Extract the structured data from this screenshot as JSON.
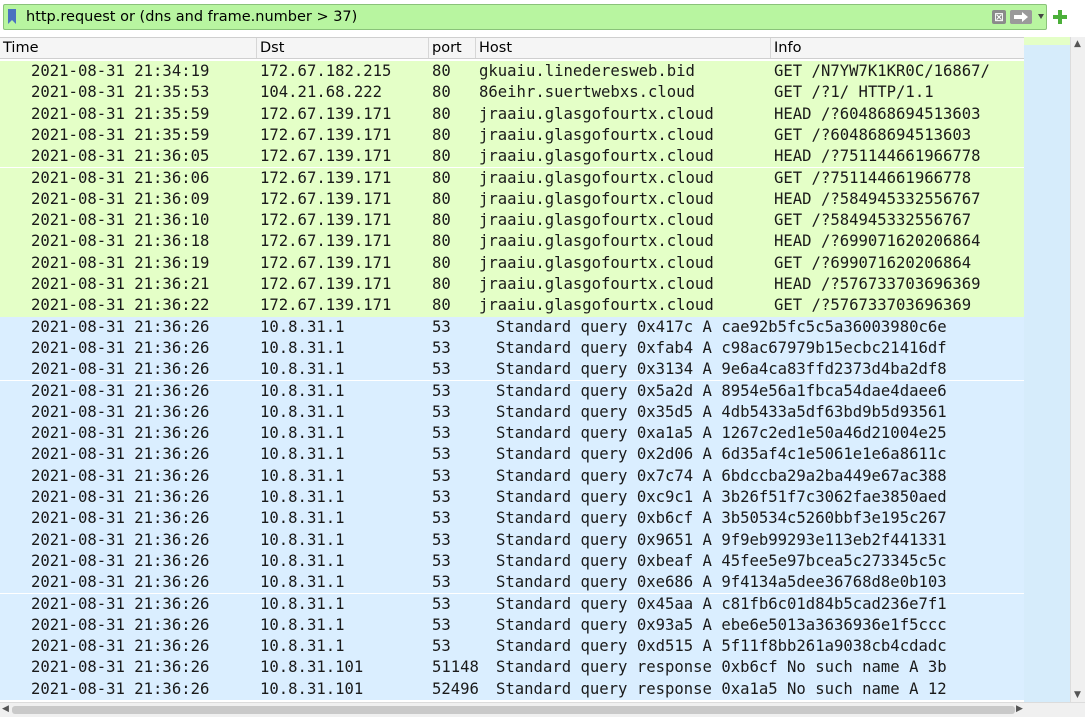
{
  "filter": {
    "value": "http.request or (dns and frame.number > 37)",
    "clear_glyph": "⊠"
  },
  "columns": [
    "Time",
    "Dst",
    "port",
    "Host",
    "Info"
  ],
  "rows": [
    {
      "kind": "http",
      "time": "2021-08-31 21:34:19",
      "dst": "172.67.182.215",
      "port": "80",
      "host": "gkuaiu.linederesweb.bid",
      "info": "GET /N7YW7K1KR0C/16867/"
    },
    {
      "kind": "http",
      "time": "2021-08-31 21:35:53",
      "dst": "104.21.68.222",
      "port": "80",
      "host": "86eihr.suertwebxs.cloud",
      "info": "GET /?1/ HTTP/1.1"
    },
    {
      "kind": "http",
      "time": "2021-08-31 21:35:59",
      "dst": "172.67.139.171",
      "port": "80",
      "host": "jraaiu.glasgofourtx.cloud",
      "info": "HEAD /?604868694513603"
    },
    {
      "kind": "http",
      "time": "2021-08-31 21:35:59",
      "dst": "172.67.139.171",
      "port": "80",
      "host": "jraaiu.glasgofourtx.cloud",
      "info": "GET /?604868694513603"
    },
    {
      "kind": "http",
      "time": "2021-08-31 21:36:05",
      "dst": "172.67.139.171",
      "port": "80",
      "host": "jraaiu.glasgofourtx.cloud",
      "info": "HEAD /?751144661966778"
    },
    {
      "kind": "http",
      "time": "2021-08-31 21:36:06",
      "dst": "172.67.139.171",
      "port": "80",
      "host": "jraaiu.glasgofourtx.cloud",
      "info": "GET /?751144661966778"
    },
    {
      "kind": "http",
      "time": "2021-08-31 21:36:09",
      "dst": "172.67.139.171",
      "port": "80",
      "host": "jraaiu.glasgofourtx.cloud",
      "info": "HEAD /?584945332556767"
    },
    {
      "kind": "http",
      "time": "2021-08-31 21:36:10",
      "dst": "172.67.139.171",
      "port": "80",
      "host": "jraaiu.glasgofourtx.cloud",
      "info": "GET /?584945332556767"
    },
    {
      "kind": "http",
      "time": "2021-08-31 21:36:18",
      "dst": "172.67.139.171",
      "port": "80",
      "host": "jraaiu.glasgofourtx.cloud",
      "info": "HEAD /?699071620206864"
    },
    {
      "kind": "http",
      "time": "2021-08-31 21:36:19",
      "dst": "172.67.139.171",
      "port": "80",
      "host": "jraaiu.glasgofourtx.cloud",
      "info": "GET /?699071620206864"
    },
    {
      "kind": "http",
      "time": "2021-08-31 21:36:21",
      "dst": "172.67.139.171",
      "port": "80",
      "host": "jraaiu.glasgofourtx.cloud",
      "info": "HEAD /?576733703696369"
    },
    {
      "kind": "http",
      "time": "2021-08-31 21:36:22",
      "dst": "172.67.139.171",
      "port": "80",
      "host": "jraaiu.glasgofourtx.cloud",
      "info": "GET /?576733703696369"
    },
    {
      "kind": "dns",
      "time": "2021-08-31 21:36:26",
      "dst": "10.8.31.1",
      "port": "53",
      "info": "Standard query 0x417c A cae92b5fc5c5a36003980c6e"
    },
    {
      "kind": "dns",
      "time": "2021-08-31 21:36:26",
      "dst": "10.8.31.1",
      "port": "53",
      "info": "Standard query 0xfab4 A c98ac67979b15ecbc21416df"
    },
    {
      "kind": "dns",
      "time": "2021-08-31 21:36:26",
      "dst": "10.8.31.1",
      "port": "53",
      "info": "Standard query 0x3134 A 9e6a4ca83ffd2373d4ba2df8"
    },
    {
      "kind": "dns",
      "time": "2021-08-31 21:36:26",
      "dst": "10.8.31.1",
      "port": "53",
      "info": "Standard query 0x5a2d A 8954e56a1fbca54dae4daee6"
    },
    {
      "kind": "dns",
      "time": "2021-08-31 21:36:26",
      "dst": "10.8.31.1",
      "port": "53",
      "info": "Standard query 0x35d5 A 4db5433a5df63bd9b5d93561"
    },
    {
      "kind": "dns",
      "time": "2021-08-31 21:36:26",
      "dst": "10.8.31.1",
      "port": "53",
      "info": "Standard query 0xa1a5 A 1267c2ed1e50a46d21004e25"
    },
    {
      "kind": "dns",
      "time": "2021-08-31 21:36:26",
      "dst": "10.8.31.1",
      "port": "53",
      "info": "Standard query 0x2d06 A 6d35af4c1e5061e1e6a8611c"
    },
    {
      "kind": "dns",
      "time": "2021-08-31 21:36:26",
      "dst": "10.8.31.1",
      "port": "53",
      "info": "Standard query 0x7c74 A 6bdccba29a2ba449e67ac388"
    },
    {
      "kind": "dns",
      "time": "2021-08-31 21:36:26",
      "dst": "10.8.31.1",
      "port": "53",
      "info": "Standard query 0xc9c1 A 3b26f51f7c3062fae3850aed"
    },
    {
      "kind": "dns",
      "time": "2021-08-31 21:36:26",
      "dst": "10.8.31.1",
      "port": "53",
      "info": "Standard query 0xb6cf A 3b50534c5260bbf3e195c267"
    },
    {
      "kind": "dns",
      "time": "2021-08-31 21:36:26",
      "dst": "10.8.31.1",
      "port": "53",
      "info": "Standard query 0x9651 A 9f9eb99293e113eb2f441331"
    },
    {
      "kind": "dns",
      "time": "2021-08-31 21:36:26",
      "dst": "10.8.31.1",
      "port": "53",
      "info": "Standard query 0xbeaf A 45fee5e97bcea5c273345c5c"
    },
    {
      "kind": "dns",
      "time": "2021-08-31 21:36:26",
      "dst": "10.8.31.1",
      "port": "53",
      "info": "Standard query 0xe686 A 9f4134a5dee36768d8e0b103"
    },
    {
      "kind": "dns",
      "time": "2021-08-31 21:36:26",
      "dst": "10.8.31.1",
      "port": "53",
      "info": "Standard query 0x45aa A c81fb6c01d84b5cad236e7f1"
    },
    {
      "kind": "dns",
      "time": "2021-08-31 21:36:26",
      "dst": "10.8.31.1",
      "port": "53",
      "info": "Standard query 0x93a5 A ebe6e5013a3636936e1f5ccc"
    },
    {
      "kind": "dns",
      "time": "2021-08-31 21:36:26",
      "dst": "10.8.31.1",
      "port": "53",
      "info": "Standard query 0xd515 A 5f11f8bb261a9038cb4cdadc"
    },
    {
      "kind": "dns",
      "time": "2021-08-31 21:36:26",
      "dst": "10.8.31.101",
      "port": "51148",
      "info": "Standard query response 0xb6cf No such name A 3b"
    },
    {
      "kind": "dns",
      "time": "2021-08-31 21:36:26",
      "dst": "10.8.31.101",
      "port": "52496",
      "info": "Standard query response 0xa1a5 No such name A 12"
    }
  ],
  "colors": {
    "http_row": "#e4ffc7",
    "dns_row": "#daeeff",
    "filter_ok": "#b8f5a0"
  },
  "icons": {
    "bookmark": "bookmark-icon",
    "clear": "clear-icon",
    "apply": "arrow-right-icon",
    "dropdown": "chevron-down-icon",
    "add": "plus-icon"
  }
}
